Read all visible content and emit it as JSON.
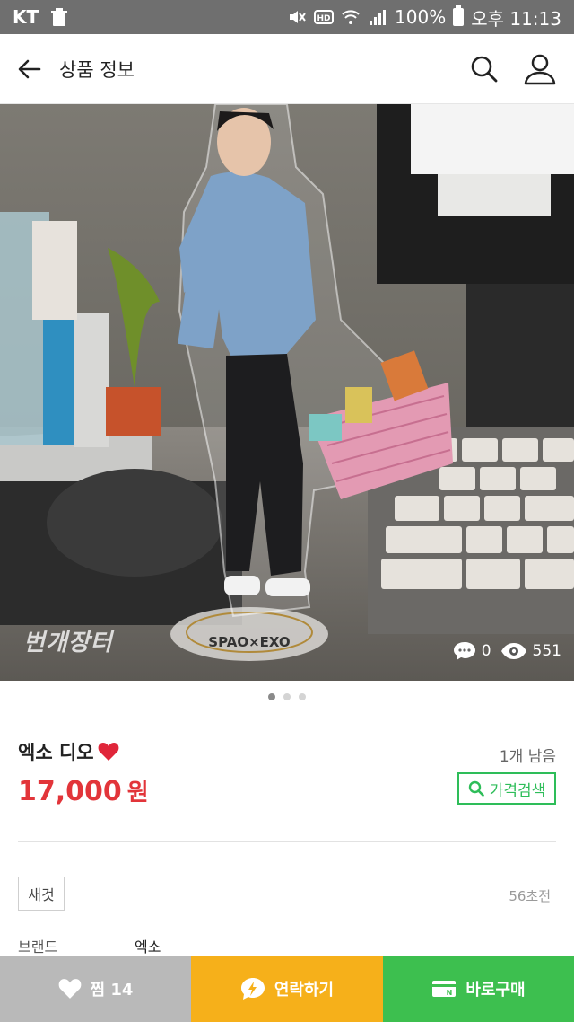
{
  "status_bar": {
    "carrier": "KT",
    "battery": "100%",
    "time": "오후 11:13"
  },
  "header": {
    "title": "상품 정보"
  },
  "photo": {
    "watermark": "번개장터",
    "comments": "0",
    "views": "551",
    "page_count": 3,
    "current_page": 1
  },
  "product": {
    "name": "엑소 디오",
    "stock": "1개 남음",
    "price": "17,000",
    "currency": "원",
    "price_check_label": "가격검색",
    "condition": "새것",
    "posted": "56초전",
    "brand_label": "브랜드",
    "brand_value": "엑소"
  },
  "bottom": {
    "like_label": "찜 14",
    "contact_label": "연락하기",
    "buy_label": "바로구매"
  },
  "colors": {
    "price": "#e2353a",
    "green": "#3dbf4f",
    "orange": "#f6b01a",
    "gray": "#b9b9b9"
  }
}
